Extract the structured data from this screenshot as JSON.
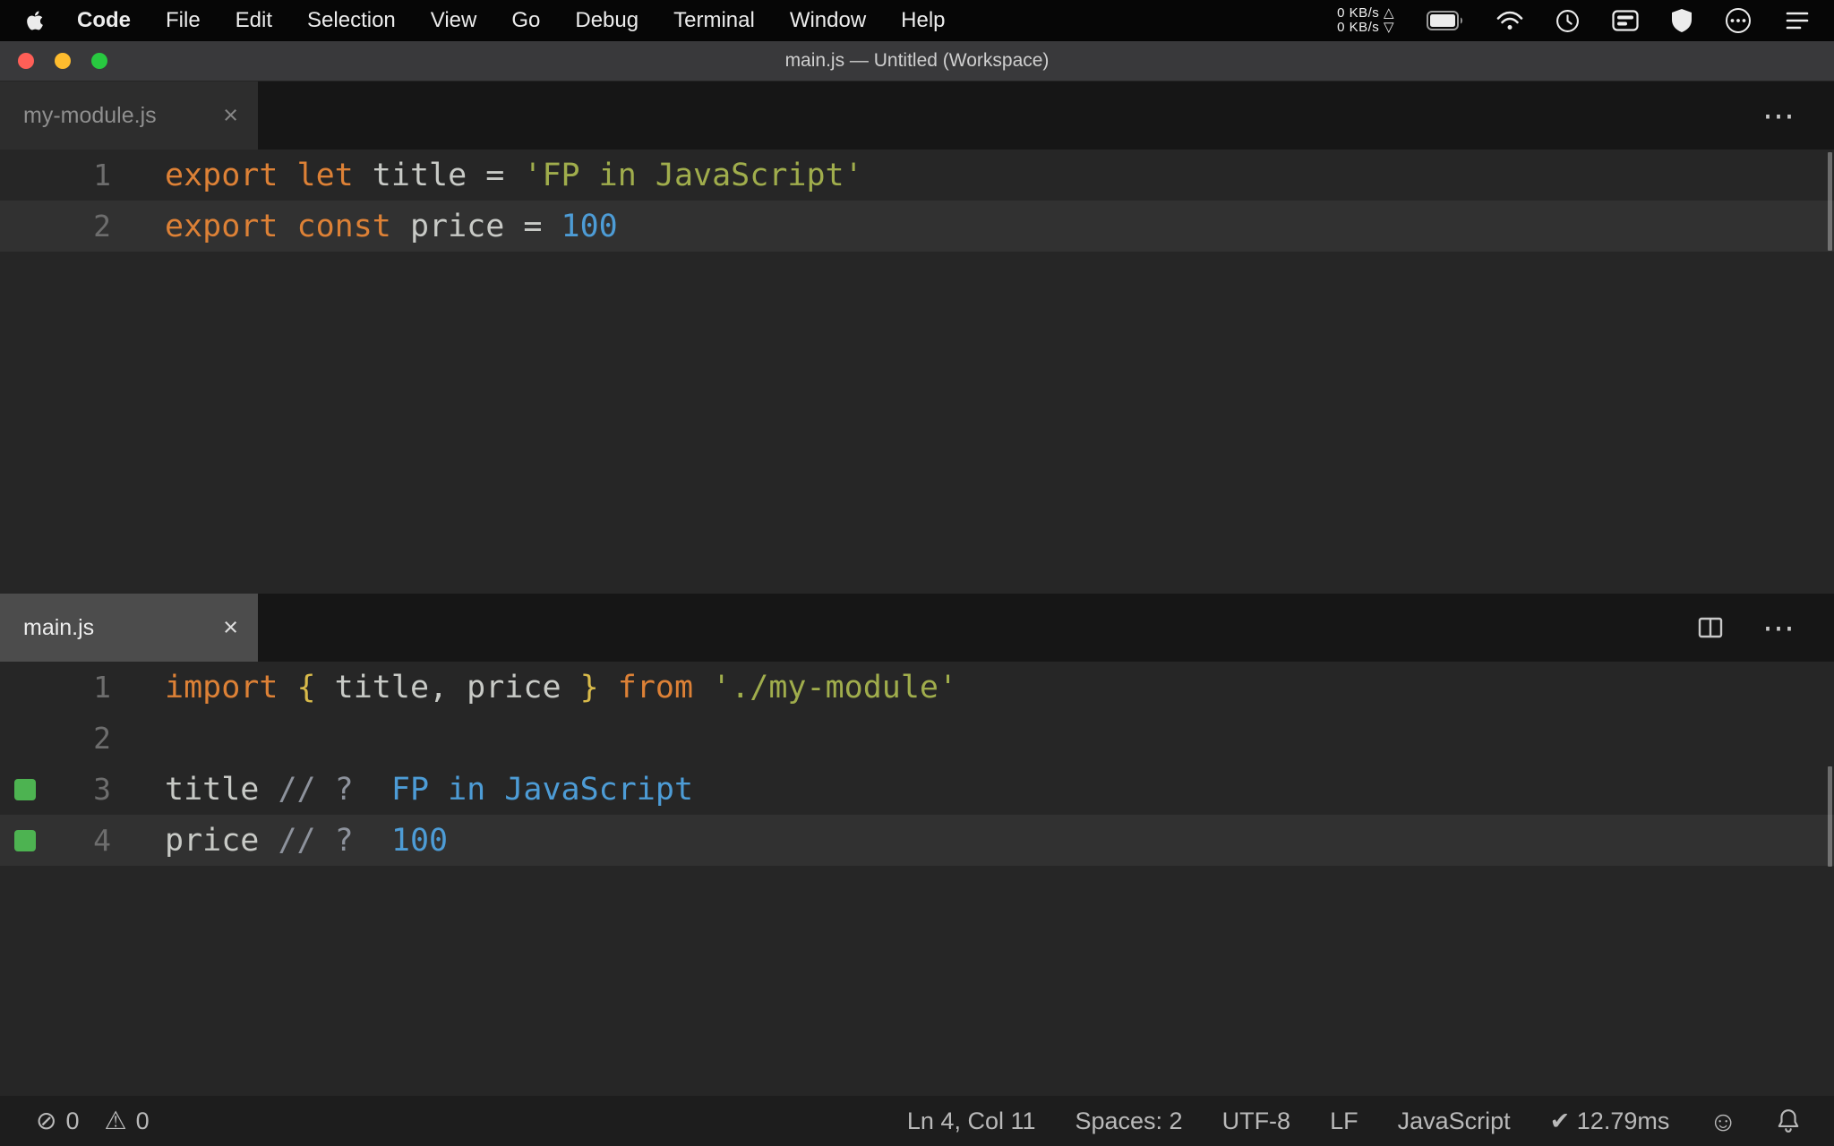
{
  "icons": {
    "close": "×",
    "ellipsis": "⋯",
    "error": "⊘",
    "warning": "⚠",
    "smiley": "☺"
  },
  "menu_bar": {
    "items": [
      "Code",
      "File",
      "Edit",
      "Selection",
      "View",
      "Go",
      "Debug",
      "Terminal",
      "Window",
      "Help"
    ],
    "network_up": "0 KB/s △",
    "network_down": "0 KB/s ▽"
  },
  "title_bar": {
    "title": "main.js — Untitled (Workspace)"
  },
  "editor_groups": [
    {
      "tab": {
        "label": "my-module.js"
      },
      "lines": [
        {
          "num": "1",
          "tokens": [
            {
              "t": "export",
              "c": "kw"
            },
            {
              "t": " ",
              "c": "pl"
            },
            {
              "t": "let",
              "c": "kw"
            },
            {
              "t": " title = ",
              "c": "pl"
            },
            {
              "t": "'FP in JavaScript'",
              "c": "str"
            }
          ]
        },
        {
          "num": "2",
          "current": true,
          "tokens": [
            {
              "t": "export",
              "c": "kw"
            },
            {
              "t": " ",
              "c": "pl"
            },
            {
              "t": "const",
              "c": "kw"
            },
            {
              "t": " price = ",
              "c": "pl"
            },
            {
              "t": "100",
              "c": "num"
            }
          ]
        }
      ]
    },
    {
      "tab": {
        "label": "main.js"
      },
      "lines": [
        {
          "num": "1",
          "tokens": [
            {
              "t": "import",
              "c": "kw"
            },
            {
              "t": " ",
              "c": "pl"
            },
            {
              "t": "{",
              "c": "brace"
            },
            {
              "t": " title, price ",
              "c": "pl"
            },
            {
              "t": "}",
              "c": "brace"
            },
            {
              "t": " ",
              "c": "pl"
            },
            {
              "t": "from",
              "c": "kw"
            },
            {
              "t": " ",
              "c": "pl"
            },
            {
              "t": "'./my-module'",
              "c": "str"
            }
          ]
        },
        {
          "num": "2",
          "tokens": []
        },
        {
          "num": "3",
          "quokka": true,
          "tokens": [
            {
              "t": "title ",
              "c": "pl"
            },
            {
              "t": "// ? ",
              "c": "cmt"
            },
            {
              "t": " FP in JavaScript",
              "c": "val"
            }
          ]
        },
        {
          "num": "4",
          "quokka": true,
          "current": true,
          "tokens": [
            {
              "t": "price ",
              "c": "pl"
            },
            {
              "t": "// ? ",
              "c": "cmt"
            },
            {
              "t": " 100",
              "c": "val"
            }
          ]
        }
      ]
    }
  ],
  "status_bar": {
    "errors": "0",
    "warnings": "0",
    "items": [
      {
        "name": "cursor-position",
        "label": "Ln 4, Col 11"
      },
      {
        "name": "indentation",
        "label": "Spaces: 2"
      },
      {
        "name": "encoding",
        "label": "UTF-8"
      },
      {
        "name": "eol",
        "label": "LF"
      },
      {
        "name": "language-mode",
        "label": "JavaScript"
      },
      {
        "name": "quokka-runtime",
        "label": "✔ 12.79ms"
      }
    ]
  },
  "colors": {
    "background": "#262626",
    "tab_strip": "#161616",
    "keyword": "#dd8136",
    "plain": "#c8cac6",
    "string": "#a0ad4c",
    "number": "#4d9cd6",
    "brace": "#d8ba4a",
    "comment": "#8d929c",
    "value": "#4d9cd6",
    "marker": "#4db351",
    "accent_red": "#ff5f57",
    "accent_yellow": "#febc2e",
    "accent_green": "#28c840"
  }
}
